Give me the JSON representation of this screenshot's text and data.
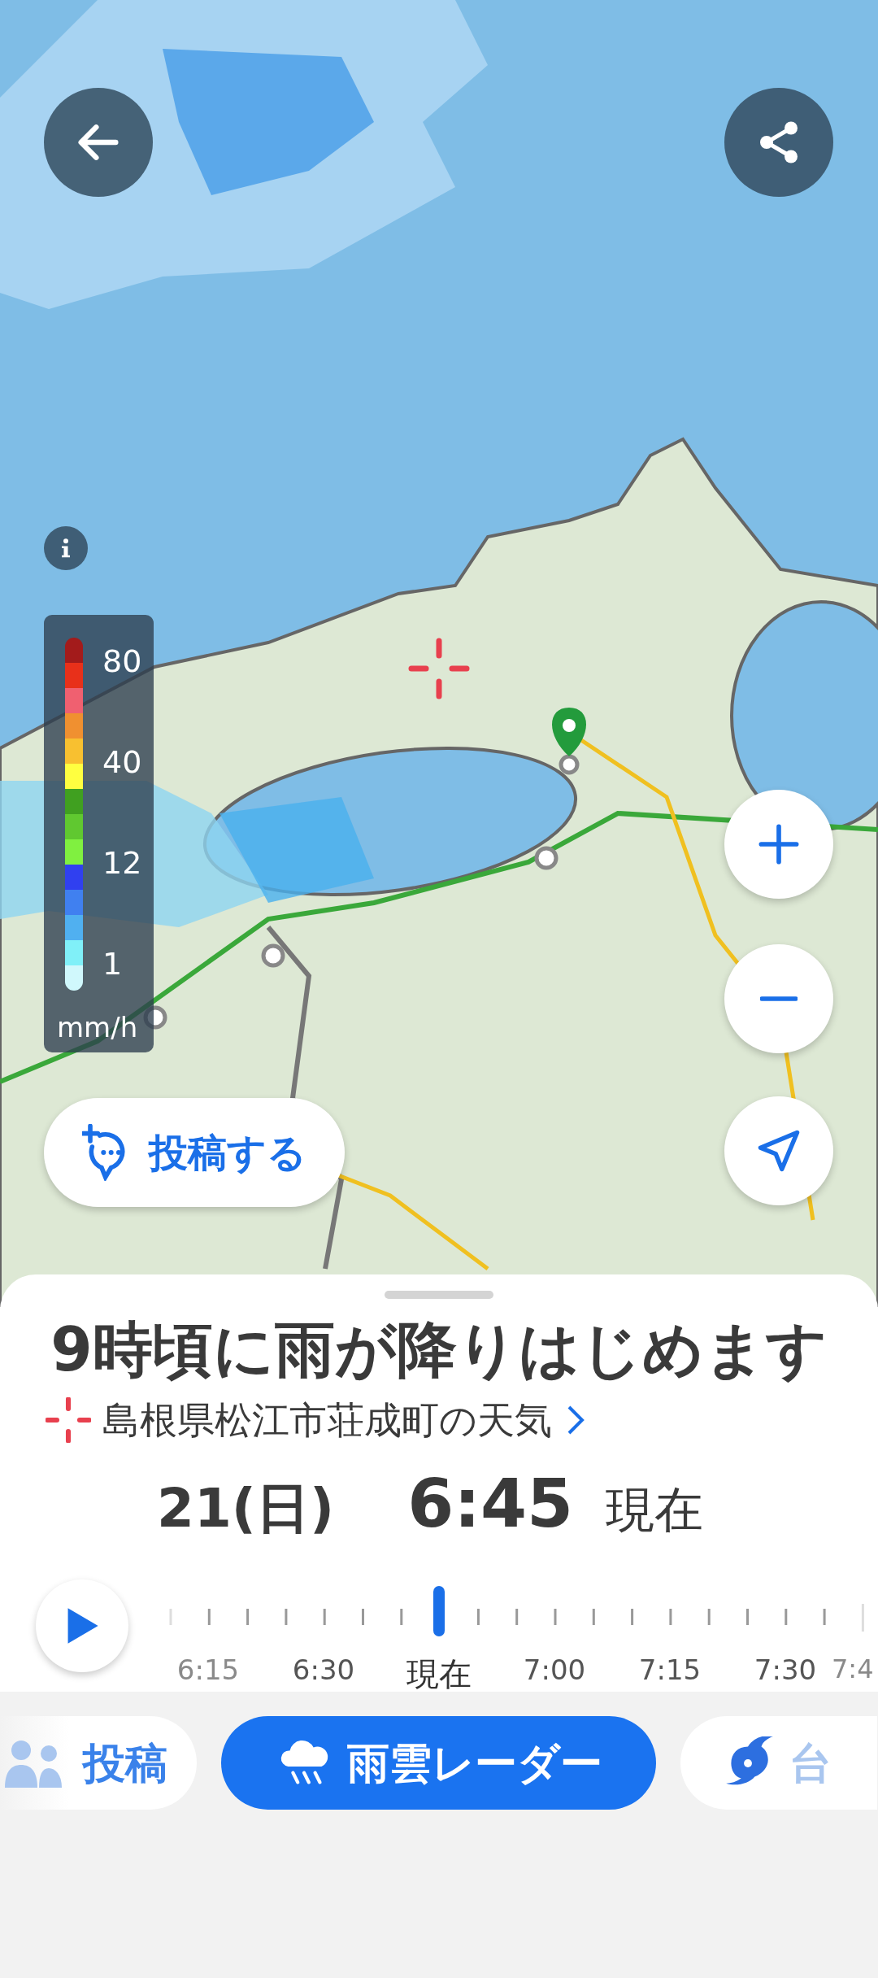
{
  "map": {
    "legend": {
      "labels": [
        "80",
        "40",
        "12",
        "1"
      ],
      "unit": "mm/h"
    },
    "post_button": {
      "label": "投稿する"
    }
  },
  "sheet": {
    "headline": "9時頃に雨が降りはじめます",
    "location": "島根県松江市荘成町の天気",
    "date": "21(日)",
    "time": "6:45",
    "time_note": "現在",
    "timeline": {
      "playing": false,
      "labels": [
        {
          "text": "6:15",
          "selected": false
        },
        {
          "text": "6:30",
          "selected": false
        },
        {
          "text": "現在",
          "selected": true
        },
        {
          "text": "7:00",
          "selected": false
        },
        {
          "text": "7:15",
          "selected": false
        },
        {
          "text": "7:30",
          "selected": false
        },
        {
          "text": "7:4",
          "selected": false
        }
      ]
    }
  },
  "tabs": [
    {
      "label": "投稿",
      "kind": "post",
      "selected": false
    },
    {
      "label": "雨雲レーダー",
      "kind": "radar",
      "selected": true
    },
    {
      "label": "台",
      "kind": "typhoon",
      "selected": false
    }
  ]
}
